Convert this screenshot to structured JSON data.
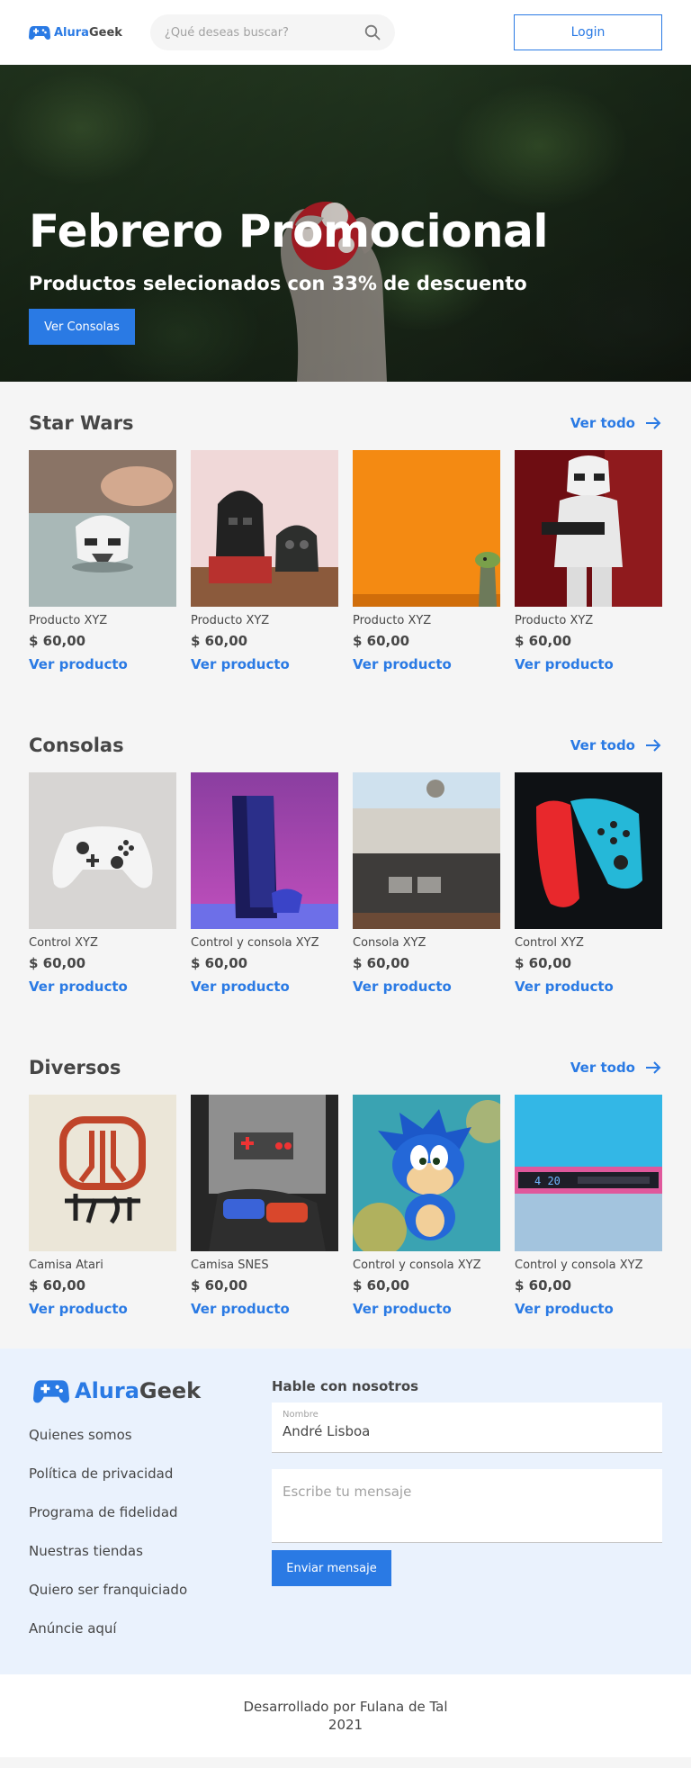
{
  "header": {
    "logo_part1": "Alura",
    "logo_part2": "Geek",
    "search_placeholder": "¿Qué deseas buscar?",
    "login_label": "Login"
  },
  "hero": {
    "title": "Febrero Promocional",
    "subtitle": "Productos selecionados con 33% de descuento",
    "button_label": "Ver Consolas"
  },
  "sections": [
    {
      "title": "Star Wars",
      "see_all": "Ver todo",
      "products": [
        {
          "name": "Producto XYZ",
          "price": "$ 60,00",
          "link": "Ver producto"
        },
        {
          "name": "Producto XYZ",
          "price": "$ 60,00",
          "link": "Ver producto"
        },
        {
          "name": "Producto XYZ",
          "price": "$ 60,00",
          "link": "Ver producto"
        },
        {
          "name": "Producto XYZ",
          "price": "$ 60,00",
          "link": "Ver producto"
        }
      ]
    },
    {
      "title": "Consolas",
      "see_all": "Ver todo",
      "products": [
        {
          "name": "Control XYZ",
          "price": "$ 60,00",
          "link": "Ver producto"
        },
        {
          "name": "Control y consola XYZ",
          "price": "$ 60,00",
          "link": "Ver producto"
        },
        {
          "name": "Consola XYZ",
          "price": "$ 60,00",
          "link": "Ver producto"
        },
        {
          "name": "Control XYZ",
          "price": "$ 60,00",
          "link": "Ver producto"
        }
      ]
    },
    {
      "title": "Diversos",
      "see_all": "Ver todo",
      "products": [
        {
          "name": "Camisa Atari",
          "price": "$ 60,00",
          "link": "Ver producto"
        },
        {
          "name": "Camisa SNES",
          "price": "$ 60,00",
          "link": "Ver producto"
        },
        {
          "name": "Control y consola XYZ",
          "price": "$ 60,00",
          "link": "Ver producto"
        },
        {
          "name": "Control y consola XYZ",
          "price": "$ 60,00",
          "link": "Ver producto"
        }
      ]
    }
  ],
  "footer": {
    "logo_part1": "Alura",
    "logo_part2": "Geek",
    "links": [
      "Quienes somos",
      "Política de privacidad",
      "Programa de fidelidad",
      "Nuestras tiendas",
      "Quiero ser franquiciado",
      "Anúncie aquí"
    ],
    "contact_title": "Hable con nosotros",
    "name_label": "Nombre",
    "name_value": "André Lisboa",
    "message_placeholder": "Escribe tu mensaje",
    "send_label": "Enviar mensaje"
  },
  "credits": {
    "line1": "Desarrollado por Fulana de Tal",
    "line2": "2021"
  },
  "product_image_motifs": [
    [
      "stormtrooper-mug",
      "darth-vader-lego",
      "yoda-orange",
      "stormtrooper-figure"
    ],
    [
      "xbox-controller",
      "ps5-console",
      "nes-console",
      "switch-joycons"
    ],
    [
      "atari-shirt",
      "snes-shirt",
      "sonic-figure",
      "retro-display"
    ]
  ],
  "colors": {
    "primary": "#2a7ae4",
    "text": "#464646",
    "background": "#f5f5f5",
    "footer_bg": "#eaf2fd"
  }
}
